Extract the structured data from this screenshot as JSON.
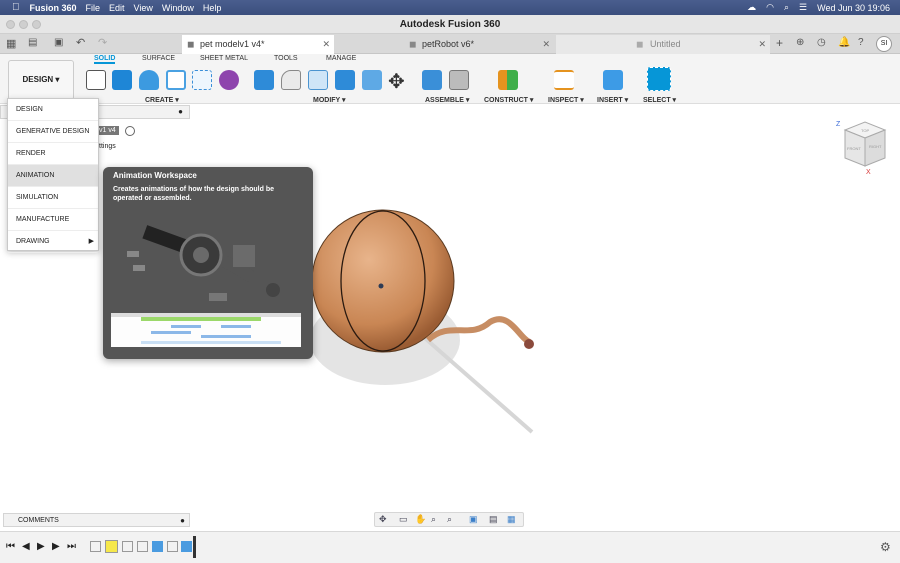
{
  "menubar": {
    "apple": "",
    "items": [
      "Fusion 360",
      "File",
      "Edit",
      "View",
      "Window",
      "Help"
    ],
    "clock": "Wed Jun 30  19:06"
  },
  "window": {
    "title": "Autodesk Fusion 360"
  },
  "doc_tabs": [
    {
      "label": "pet modelv1 v4*",
      "active": true
    },
    {
      "label": "petRobot v6*",
      "active": false
    },
    {
      "label": "Untitled",
      "active": false
    }
  ],
  "toolbar": {
    "workspace_label": "DESIGN ▾",
    "subtabs": [
      "SOLID",
      "SURFACE",
      "SHEET METAL",
      "TOOLS",
      "MANAGE"
    ],
    "groups": [
      "CREATE ▾",
      "MODIFY ▾",
      "ASSEMBLE ▾",
      "CONSTRUCT ▾",
      "INSPECT ▾",
      "INSERT ▾",
      "SELECT ▾"
    ]
  },
  "workspace_menu": {
    "items": [
      "DESIGN",
      "GENERATIVE DESIGN",
      "RENDER",
      "ANIMATION",
      "SIMULATION",
      "MANUFACTURE",
      "DRAWING"
    ],
    "selected": "ANIMATION"
  },
  "tooltip": {
    "title": "Animation Workspace",
    "body": "Creates animations of how the design should be operated or assembled."
  },
  "browser": {
    "partial_version": "v1 v4",
    "partial_settings": "ttings"
  },
  "comments": {
    "label": "COMMENTS"
  },
  "viewcube": {
    "faces": [
      "TOP",
      "FRONT",
      "RIGHT"
    ],
    "axes": [
      "Z",
      "X"
    ]
  },
  "user": {
    "initials": "SI"
  },
  "colors": {
    "accent": "#0696d7",
    "tooltip_bg": "#555555",
    "menubar": "#3f5382"
  }
}
